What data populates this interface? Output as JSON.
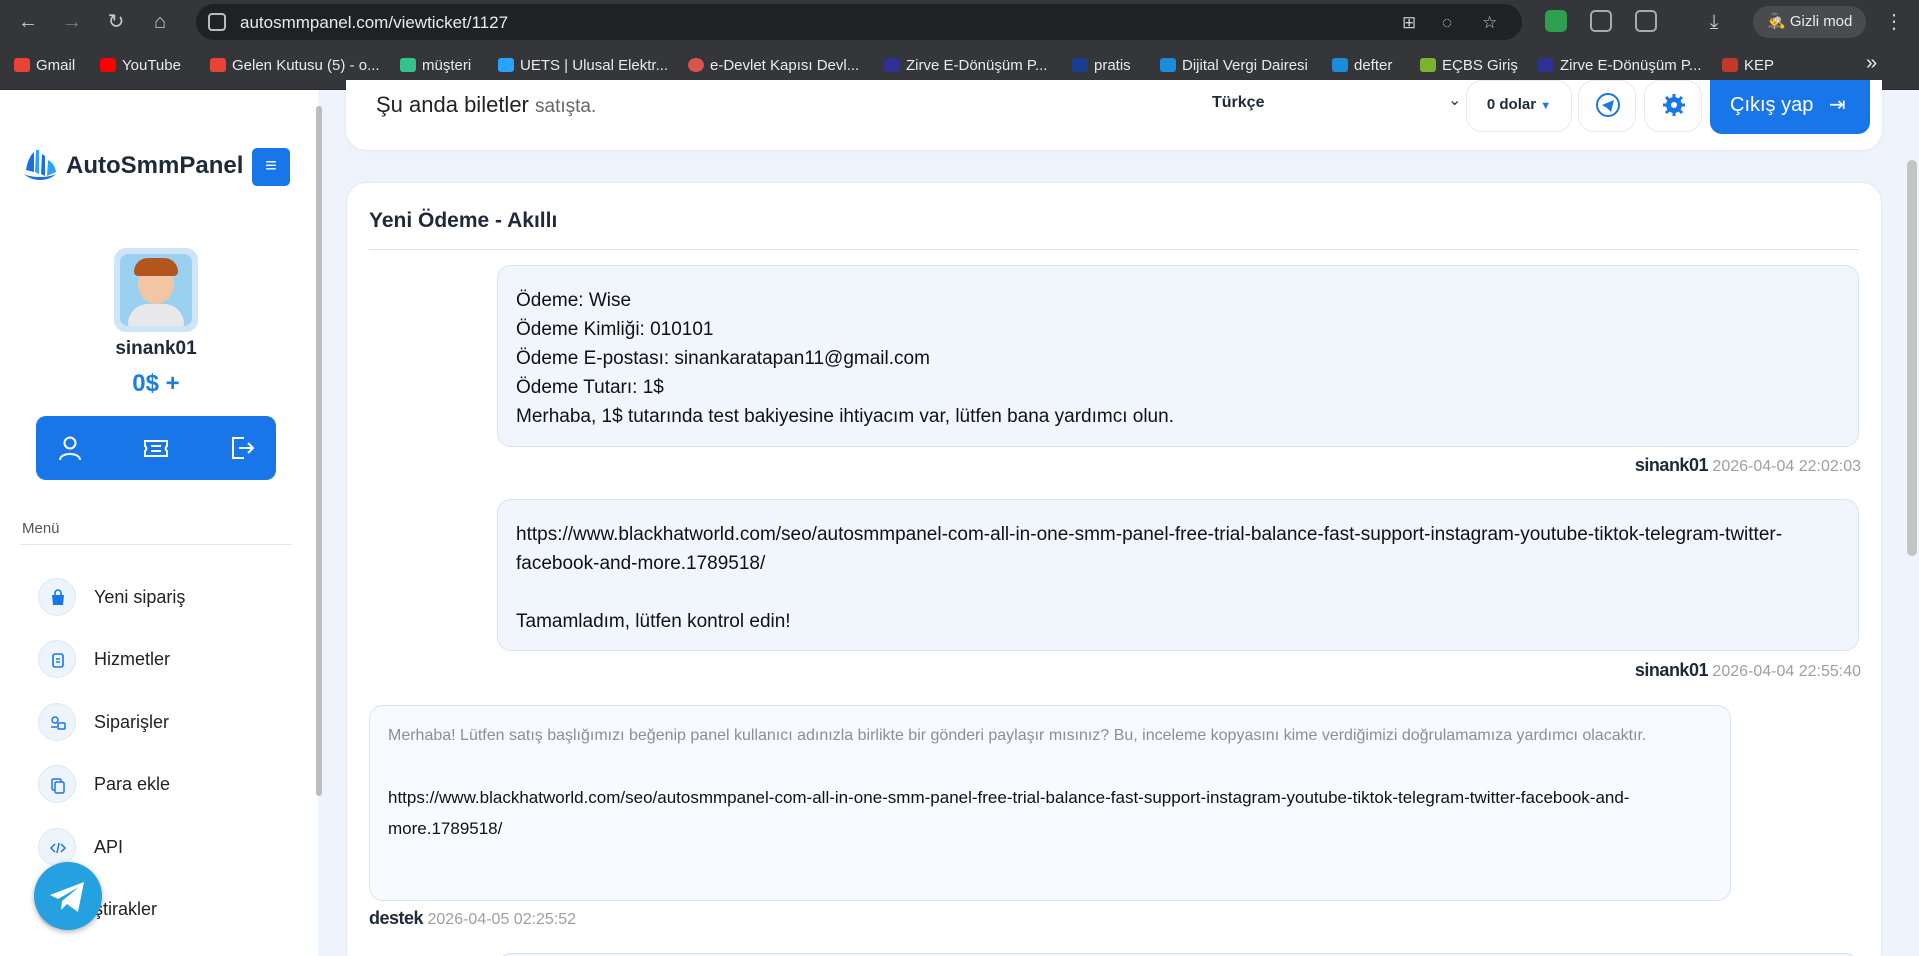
{
  "browser": {
    "url": "autosmmpanel.com/viewticket/1127",
    "incognito_label": "Gizli mod",
    "bookmarks": [
      {
        "label": "Gmail",
        "color": "#ea4335"
      },
      {
        "label": "YouTube",
        "color": "#ff0000"
      },
      {
        "label": "Gelen Kutusu (5) - o...",
        "color": "#ea4335"
      },
      {
        "label": "müşteri",
        "color": "#34c38f"
      },
      {
        "label": "UETS | Ulusal Elektr...",
        "color": "#29a3ff"
      },
      {
        "label": "e-Devlet Kapısı Devl...",
        "color": "#d9534f"
      },
      {
        "label": "Zirve E-Dönüşüm P...",
        "color": "#2e3192"
      },
      {
        "label": "pratis",
        "color": "#1a3d8f"
      },
      {
        "label": "Dijital Vergi Dairesi",
        "color": "#1a8cd8"
      },
      {
        "label": "defter",
        "color": "#1a8cd8"
      },
      {
        "label": "EÇBS Giriş",
        "color": "#7bb32e"
      },
      {
        "label": "Zirve E-Dönüşüm P...",
        "color": "#2e3192"
      },
      {
        "label": "KEP",
        "color": "#c0392b"
      }
    ],
    "more": "»"
  },
  "sidebar": {
    "brand": "AutoSmmPanel",
    "username": "sinank01",
    "balance": "0$ +",
    "menu_title": "Menü",
    "items": [
      {
        "label": "Yeni sipariş",
        "icon": "bag-icon"
      },
      {
        "label": "Hizmetler",
        "icon": "clipboard-icon"
      },
      {
        "label": "Siparişler",
        "icon": "orders-icon"
      },
      {
        "label": "Para ekle",
        "icon": "copy-icon"
      },
      {
        "label": "API",
        "icon": "code-icon"
      },
      {
        "label": "Ortaklıklar",
        "visible": "ştirakler",
        "icon": "affiliate-icon"
      }
    ]
  },
  "header": {
    "notice_main": "Şu anda biletler",
    "notice_sub": "satışta.",
    "language": "Türkçe",
    "currency": "0 dolar",
    "logout": "Çıkış yap"
  },
  "ticket": {
    "title": "Yeni Ödeme - Akıllı",
    "messages": [
      {
        "text": "Ödeme: Wise\nÖdeme Kimliği: 010101\nÖdeme E-postası: sinankaratapan11@gmail.com\nÖdeme Tutarı: 1$\nMerhaba, 1$ tutarında test bakiyesine ihtiyacım var, lütfen bana yardımcı olun.",
        "author": "sinank01",
        "time": "2026-04-04 22:02:03"
      },
      {
        "text": "https://www.blackhatworld.com/seo/autosmmpanel-com-all-in-one-smm-panel-free-trial-balance-fast-support-instagram-youtube-tiktok-telegram-twitter-facebook-and-more.1789518/\n\nTamamladım, lütfen kontrol edin!",
        "author": "sinank01",
        "time": "2026-04-04 22:55:40"
      },
      {
        "gray": "Merhaba! Lütfen satış başlığımızı beğenip panel kullanıcı adınızla birlikte bir gönderi paylaşır mısınız? Bu, inceleme kopyasını kime verdiğimizi doğrulamamıza yardımcı olacaktır.",
        "text": "https://www.blackhatworld.com/seo/autosmmpanel-com-all-in-one-smm-panel-free-trial-balance-fast-support-instagram-youtube-tiktok-telegram-twitter-facebook-and-more.1789518/",
        "author": "destek",
        "time": "2026-04-05 02:25:52"
      }
    ]
  },
  "colors": {
    "accent": "#1976e8",
    "page_bg": "#eef3fc",
    "telegram": "#24a1de"
  }
}
